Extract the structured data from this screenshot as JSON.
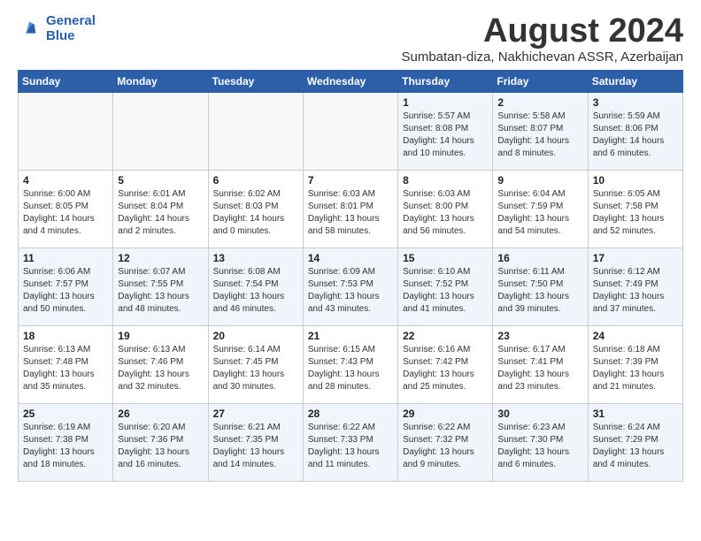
{
  "header": {
    "logo_line1": "General",
    "logo_line2": "Blue",
    "month": "August 2024",
    "location": "Sumbatan-diza, Nakhichevan ASSR, Azerbaijan"
  },
  "weekdays": [
    "Sunday",
    "Monday",
    "Tuesday",
    "Wednesday",
    "Thursday",
    "Friday",
    "Saturday"
  ],
  "weeks": [
    [
      {
        "day": "",
        "info": ""
      },
      {
        "day": "",
        "info": ""
      },
      {
        "day": "",
        "info": ""
      },
      {
        "day": "",
        "info": ""
      },
      {
        "day": "1",
        "info": "Sunrise: 5:57 AM\nSunset: 8:08 PM\nDaylight: 14 hours\nand 10 minutes."
      },
      {
        "day": "2",
        "info": "Sunrise: 5:58 AM\nSunset: 8:07 PM\nDaylight: 14 hours\nand 8 minutes."
      },
      {
        "day": "3",
        "info": "Sunrise: 5:59 AM\nSunset: 8:06 PM\nDaylight: 14 hours\nand 6 minutes."
      }
    ],
    [
      {
        "day": "4",
        "info": "Sunrise: 6:00 AM\nSunset: 8:05 PM\nDaylight: 14 hours\nand 4 minutes."
      },
      {
        "day": "5",
        "info": "Sunrise: 6:01 AM\nSunset: 8:04 PM\nDaylight: 14 hours\nand 2 minutes."
      },
      {
        "day": "6",
        "info": "Sunrise: 6:02 AM\nSunset: 8:03 PM\nDaylight: 14 hours\nand 0 minutes."
      },
      {
        "day": "7",
        "info": "Sunrise: 6:03 AM\nSunset: 8:01 PM\nDaylight: 13 hours\nand 58 minutes."
      },
      {
        "day": "8",
        "info": "Sunrise: 6:03 AM\nSunset: 8:00 PM\nDaylight: 13 hours\nand 56 minutes."
      },
      {
        "day": "9",
        "info": "Sunrise: 6:04 AM\nSunset: 7:59 PM\nDaylight: 13 hours\nand 54 minutes."
      },
      {
        "day": "10",
        "info": "Sunrise: 6:05 AM\nSunset: 7:58 PM\nDaylight: 13 hours\nand 52 minutes."
      }
    ],
    [
      {
        "day": "11",
        "info": "Sunrise: 6:06 AM\nSunset: 7:57 PM\nDaylight: 13 hours\nand 50 minutes."
      },
      {
        "day": "12",
        "info": "Sunrise: 6:07 AM\nSunset: 7:55 PM\nDaylight: 13 hours\nand 48 minutes."
      },
      {
        "day": "13",
        "info": "Sunrise: 6:08 AM\nSunset: 7:54 PM\nDaylight: 13 hours\nand 46 minutes."
      },
      {
        "day": "14",
        "info": "Sunrise: 6:09 AM\nSunset: 7:53 PM\nDaylight: 13 hours\nand 43 minutes."
      },
      {
        "day": "15",
        "info": "Sunrise: 6:10 AM\nSunset: 7:52 PM\nDaylight: 13 hours\nand 41 minutes."
      },
      {
        "day": "16",
        "info": "Sunrise: 6:11 AM\nSunset: 7:50 PM\nDaylight: 13 hours\nand 39 minutes."
      },
      {
        "day": "17",
        "info": "Sunrise: 6:12 AM\nSunset: 7:49 PM\nDaylight: 13 hours\nand 37 minutes."
      }
    ],
    [
      {
        "day": "18",
        "info": "Sunrise: 6:13 AM\nSunset: 7:48 PM\nDaylight: 13 hours\nand 35 minutes."
      },
      {
        "day": "19",
        "info": "Sunrise: 6:13 AM\nSunset: 7:46 PM\nDaylight: 13 hours\nand 32 minutes."
      },
      {
        "day": "20",
        "info": "Sunrise: 6:14 AM\nSunset: 7:45 PM\nDaylight: 13 hours\nand 30 minutes."
      },
      {
        "day": "21",
        "info": "Sunrise: 6:15 AM\nSunset: 7:43 PM\nDaylight: 13 hours\nand 28 minutes."
      },
      {
        "day": "22",
        "info": "Sunrise: 6:16 AM\nSunset: 7:42 PM\nDaylight: 13 hours\nand 25 minutes."
      },
      {
        "day": "23",
        "info": "Sunrise: 6:17 AM\nSunset: 7:41 PM\nDaylight: 13 hours\nand 23 minutes."
      },
      {
        "day": "24",
        "info": "Sunrise: 6:18 AM\nSunset: 7:39 PM\nDaylight: 13 hours\nand 21 minutes."
      }
    ],
    [
      {
        "day": "25",
        "info": "Sunrise: 6:19 AM\nSunset: 7:38 PM\nDaylight: 13 hours\nand 18 minutes."
      },
      {
        "day": "26",
        "info": "Sunrise: 6:20 AM\nSunset: 7:36 PM\nDaylight: 13 hours\nand 16 minutes."
      },
      {
        "day": "27",
        "info": "Sunrise: 6:21 AM\nSunset: 7:35 PM\nDaylight: 13 hours\nand 14 minutes."
      },
      {
        "day": "28",
        "info": "Sunrise: 6:22 AM\nSunset: 7:33 PM\nDaylight: 13 hours\nand 11 minutes."
      },
      {
        "day": "29",
        "info": "Sunrise: 6:22 AM\nSunset: 7:32 PM\nDaylight: 13 hours\nand 9 minutes."
      },
      {
        "day": "30",
        "info": "Sunrise: 6:23 AM\nSunset: 7:30 PM\nDaylight: 13 hours\nand 6 minutes."
      },
      {
        "day": "31",
        "info": "Sunrise: 6:24 AM\nSunset: 7:29 PM\nDaylight: 13 hours\nand 4 minutes."
      }
    ]
  ]
}
